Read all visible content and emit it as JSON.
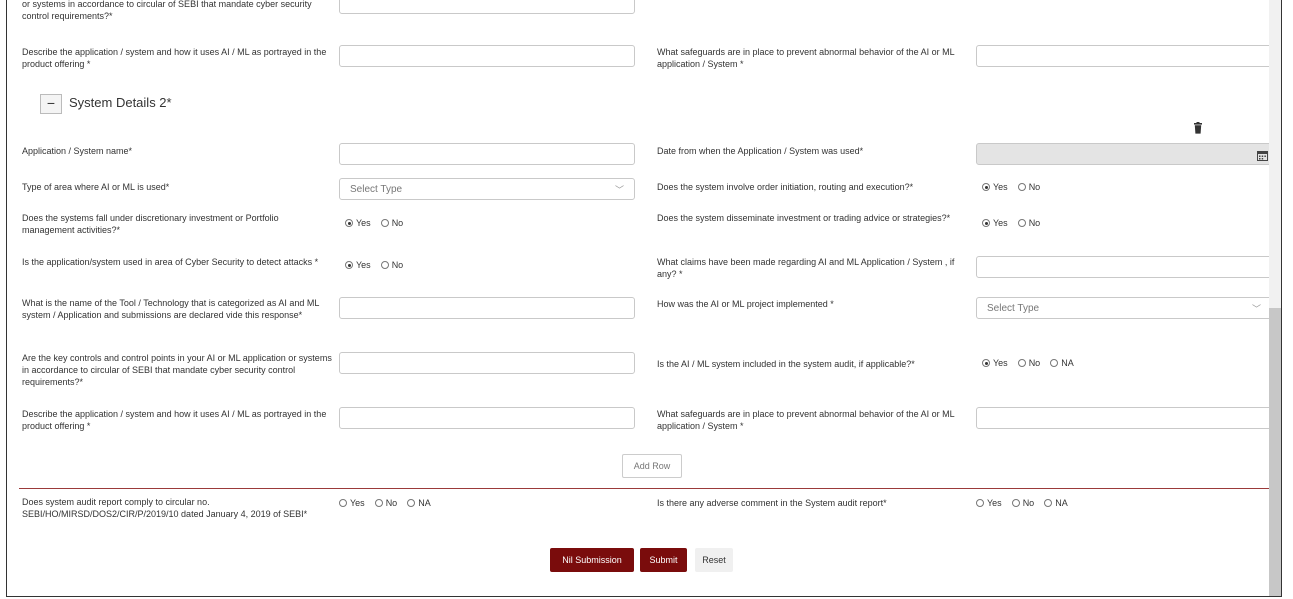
{
  "top_partial_question": "or systems in accordance to circular of SEBI that mandate cyber security control requirements?*",
  "section1": {
    "describe_label": "Describe the application / system and how it uses AI / ML as portrayed in the product offering *",
    "safeguards_label": "What safeguards are in place to prevent abnormal behavior of the AI or ML application / System *"
  },
  "section2": {
    "collapse_symbol": "−",
    "title": "System Details 2*",
    "app_name_label": "Application / System name*",
    "date_label": "Date from when the Application / System was used*",
    "area_label": "Type of area where AI or ML is used*",
    "area_select": "Select Type",
    "order_label": "Does the system involve order initiation, routing and execution?*",
    "discretionary_label": "Does the systems fall under discretionary investment or Portfolio management activities?*",
    "disseminate_label": "Does the system disseminate investment or trading advice or strategies?*",
    "cyber_label": "Is the application/system used in area of Cyber Security to detect attacks *",
    "claims_label": "What claims have been made regarding AI and ML Application / System , if any? *",
    "tool_label": "What is the name of the Tool / Technology that is categorized as AI and ML system / Application and submissions are declared vide this response*",
    "implemented_label": "How was the AI or ML project implemented *",
    "implemented_select": "Select Type",
    "controls_label": "Are the key controls and control points in your AI or ML application or systems in accordance to circular of SEBI that mandate cyber security control requirements?*",
    "audit_included_label": "Is the AI / ML system included in the system audit, if applicable?*",
    "describe_label": "Describe the application / system and how it uses AI / ML as portrayed in the product offering *",
    "safeguards_label": "What safeguards are in place to prevent abnormal behavior of the AI or ML application / System *"
  },
  "radio": {
    "yes": "Yes",
    "no": "No",
    "na": "NA"
  },
  "add_row": "Add Row",
  "audit": {
    "comply_label": "Does system audit report comply to circular no. SEBI/HO/MIRSD/DOS2/CIR/P/2019/10 dated January 4, 2019 of SEBI*",
    "adverse_label": "Is there any adverse comment in the System audit report*"
  },
  "buttons": {
    "nil": "Nil Submission",
    "submit": "Submit",
    "reset": "Reset"
  },
  "colors": {
    "accent": "#7a0c0c",
    "divider": "#9b3a3a"
  }
}
